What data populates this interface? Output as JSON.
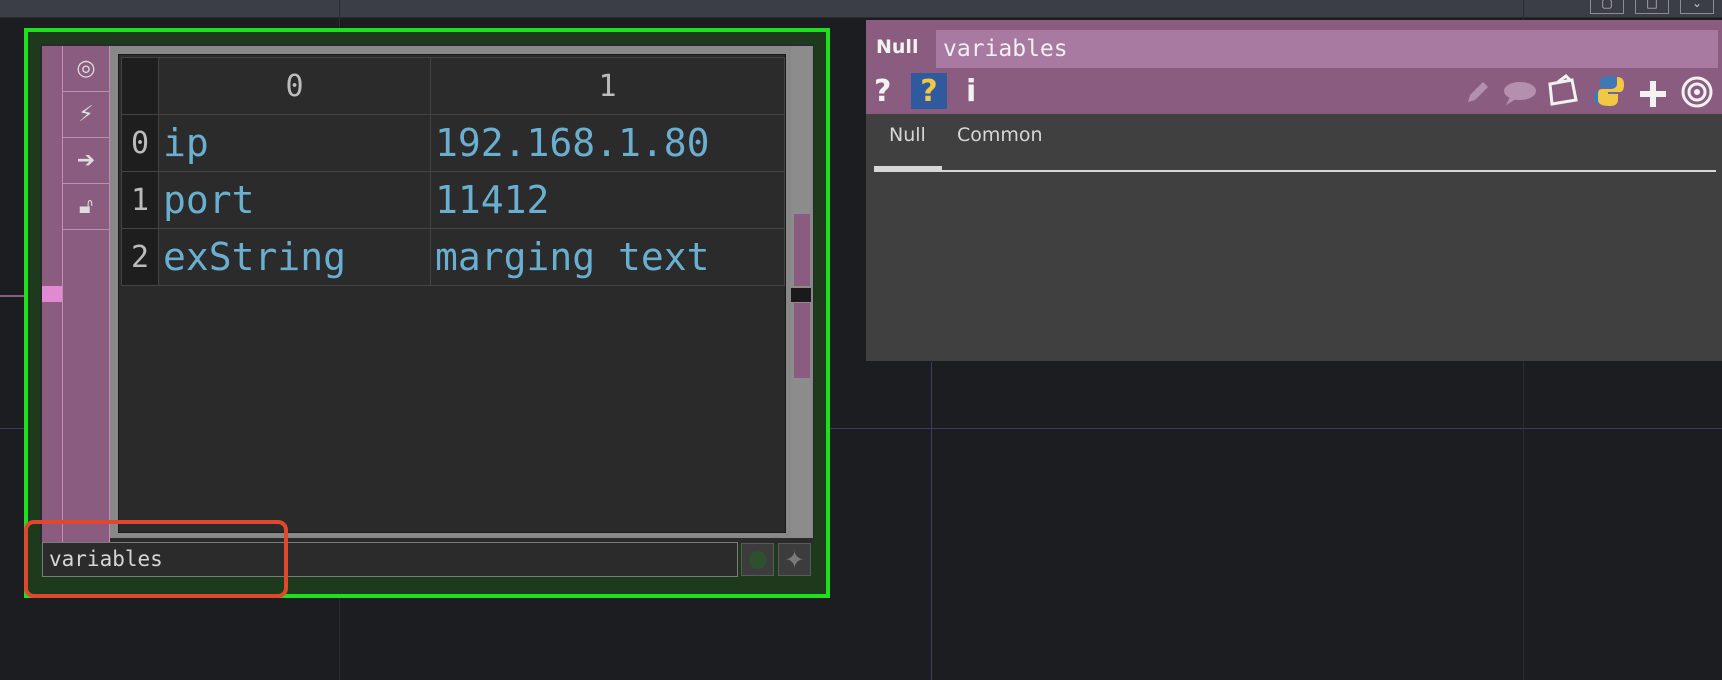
{
  "node": {
    "name": "variables",
    "table": {
      "col_headers": [
        "0",
        "1"
      ],
      "rows": [
        {
          "index": "0",
          "key": "ip",
          "value": "192.168.1.80"
        },
        {
          "index": "1",
          "key": "port",
          "value": "11412"
        },
        {
          "index": "2",
          "key": "exString",
          "value": "marging text"
        }
      ]
    },
    "flags": [
      "viewer-flag-icon",
      "bypass-icon",
      "display-icon",
      "lock-icon"
    ],
    "buttons": [
      "viewer-active-icon",
      "add-icon"
    ]
  },
  "panel": {
    "op_type": "Null",
    "op_name": "variables",
    "toolbar_icons": {
      "help": "?",
      "help_operator": "?",
      "info": "i"
    },
    "tabs": [
      "Null",
      "Common"
    ],
    "active_tab": "Null"
  },
  "colors": {
    "node_select": "#1fe01f",
    "dat_pink": "#8a5d80",
    "cell_text": "#6aaed0",
    "highlight": "#e0482e"
  }
}
